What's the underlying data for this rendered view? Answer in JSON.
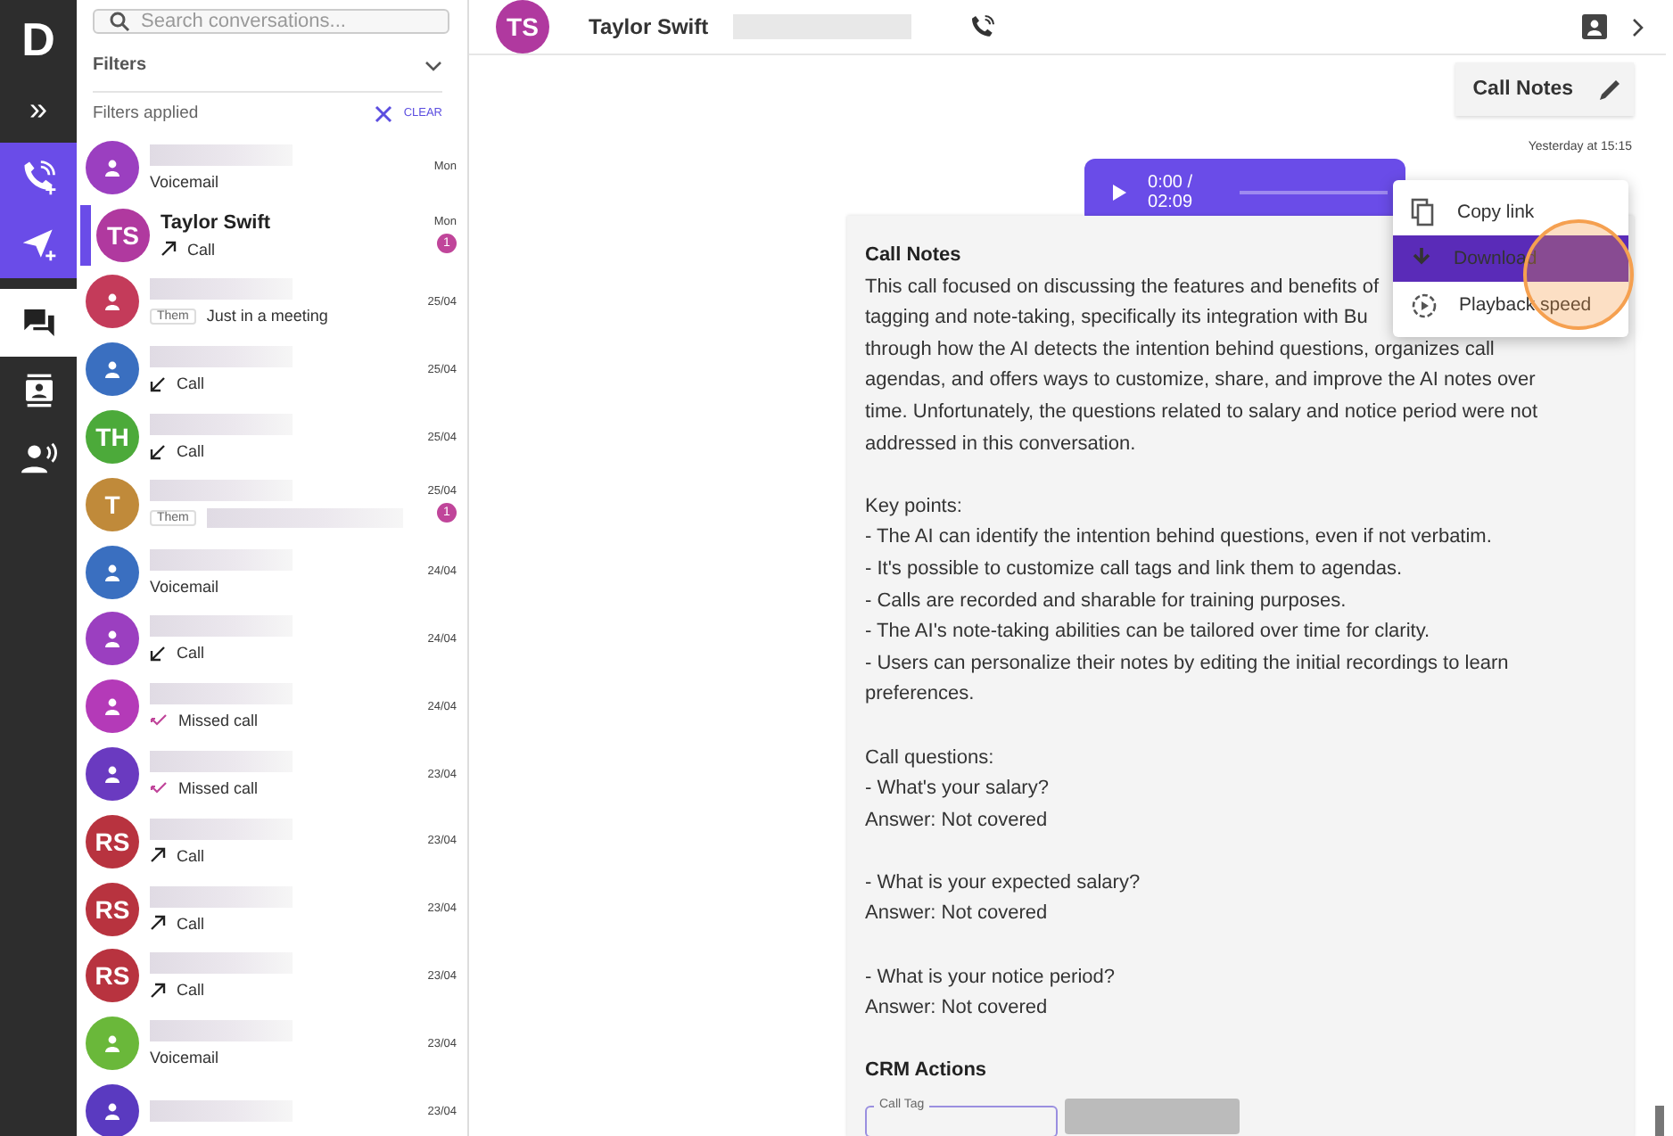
{
  "rail": {
    "logo": "D",
    "expand": "»",
    "items": [
      {
        "kind": "call",
        "accent": true,
        "selected": false
      },
      {
        "kind": "send",
        "accent": true,
        "selected": false
      },
      {
        "kind": "chat",
        "accent": false,
        "selected": true
      },
      {
        "kind": "contacts",
        "accent": false,
        "selected": false
      },
      {
        "kind": "voice",
        "accent": false,
        "selected": false
      }
    ]
  },
  "sidebar": {
    "search": {
      "placeholder": "Search conversations..."
    },
    "filters": {
      "label": "Filters",
      "expanded": false
    },
    "filters_applied": {
      "label": "Filters applied",
      "clear": "CLEAR"
    },
    "conversations": [
      {
        "avatar": {
          "kind": "person",
          "color": "#9b3fc0"
        },
        "date": "Mon",
        "preview": {
          "kind": "voicemail",
          "text": "Voicemail"
        },
        "selected": false
      },
      {
        "avatar": {
          "kind": "initials",
          "initials": "TS",
          "color": "#b0399f"
        },
        "name": "Taylor Swift",
        "date": "Mon",
        "badge": "1",
        "preview": {
          "kind": "outgoing",
          "text": "Call"
        },
        "selected": true
      },
      {
        "avatar": {
          "kind": "person",
          "color": "#c43b5a"
        },
        "date": "25/04",
        "preview": {
          "kind": "message",
          "tag": "Them",
          "text": "Just in a meeting"
        },
        "selected": false
      },
      {
        "avatar": {
          "kind": "person",
          "color": "#3a6fc0"
        },
        "date": "25/04",
        "preview": {
          "kind": "incoming",
          "text": "Call"
        },
        "selected": false
      },
      {
        "avatar": {
          "kind": "initials",
          "initials": "TH",
          "color": "#4caa3a"
        },
        "date": "25/04",
        "preview": {
          "kind": "incoming",
          "text": "Call"
        },
        "selected": false
      },
      {
        "avatar": {
          "kind": "initials",
          "initials": "T",
          "color": "#c08a3a"
        },
        "date": "25/04",
        "badge": "1",
        "preview": {
          "kind": "message",
          "tag": "Them"
        },
        "selected": false
      },
      {
        "avatar": {
          "kind": "person",
          "color": "#3a6fc0"
        },
        "date": "24/04",
        "preview": {
          "kind": "voicemail",
          "text": "Voicemail"
        },
        "selected": false
      },
      {
        "avatar": {
          "kind": "person",
          "color": "#9b3fc0"
        },
        "date": "24/04",
        "preview": {
          "kind": "incoming",
          "text": "Call"
        },
        "selected": false
      },
      {
        "avatar": {
          "kind": "person",
          "color": "#b43ab8"
        },
        "date": "24/04",
        "preview": {
          "kind": "missed",
          "text": "Missed call"
        },
        "selected": false
      },
      {
        "avatar": {
          "kind": "person",
          "color": "#6a3ac0"
        },
        "date": "23/04",
        "preview": {
          "kind": "missed",
          "text": "Missed call"
        },
        "selected": false
      },
      {
        "avatar": {
          "kind": "initials",
          "initials": "RS",
          "color": "#b8333f"
        },
        "date": "23/04",
        "preview": {
          "kind": "outgoing",
          "text": "Call"
        },
        "selected": false
      },
      {
        "avatar": {
          "kind": "initials",
          "initials": "RS",
          "color": "#b8333f"
        },
        "date": "23/04",
        "preview": {
          "kind": "outgoing",
          "text": "Call"
        },
        "selected": false
      },
      {
        "avatar": {
          "kind": "initials",
          "initials": "RS",
          "color": "#b8333f"
        },
        "date": "23/04",
        "preview": {
          "kind": "outgoing",
          "text": "Call"
        },
        "selected": false
      },
      {
        "avatar": {
          "kind": "person",
          "color": "#6ab83a"
        },
        "date": "23/04",
        "preview": {
          "kind": "voicemail",
          "text": "Voicemail"
        },
        "selected": false
      },
      {
        "avatar": {
          "kind": "person",
          "color": "#5a3ac0"
        },
        "date": "23/04",
        "selected": false
      }
    ]
  },
  "header": {
    "avatar": {
      "initials": "TS",
      "color": "#b0399f"
    },
    "name": "Taylor Swift"
  },
  "call_notes_button": "Call Notes",
  "message": {
    "time": "Yesterday at 15:15",
    "player": {
      "time": "0:00 / 02:09"
    },
    "menu": [
      {
        "kind": "copy",
        "label": "Copy link",
        "selected": false
      },
      {
        "kind": "download",
        "label": "Download",
        "selected": true
      },
      {
        "kind": "speed",
        "label": "Playback speed",
        "selected": false
      }
    ],
    "notes": [
      {
        "kind": "heading",
        "text": "Call Notes"
      },
      {
        "kind": "line",
        "text": "This call focused on discussing the features and benefits of"
      },
      {
        "kind": "line",
        "text": "tagging and note-taking, specifically its integration with Bu"
      },
      {
        "kind": "line",
        "text": "through how the AI detects the intention behind questions, organizes call"
      },
      {
        "kind": "line",
        "text": "agendas, and offers ways to customize, share, and improve the AI notes over"
      },
      {
        "kind": "line",
        "text": "time. Unfortunately, the questions related to salary and notice period were not"
      },
      {
        "kind": "line",
        "text": "addressed in this conversation."
      },
      {
        "kind": "gap"
      },
      {
        "kind": "line",
        "text": "Key points:"
      },
      {
        "kind": "line",
        "text": "- The AI can identify the intention behind questions, even if not verbatim."
      },
      {
        "kind": "line",
        "text": "- It's possible to customize call tags and link them to agendas."
      },
      {
        "kind": "line",
        "text": "- Calls are recorded and sharable for training purposes."
      },
      {
        "kind": "line",
        "text": "- The AI's note-taking abilities can be tailored over time for clarity."
      },
      {
        "kind": "line",
        "text": "- Users can personalize their notes by editing the initial recordings to learn"
      },
      {
        "kind": "line",
        "text": "preferences."
      },
      {
        "kind": "gap"
      },
      {
        "kind": "line",
        "text": "Call questions:"
      },
      {
        "kind": "line",
        "text": "- What's your salary?"
      },
      {
        "kind": "line",
        "text": "Answer: Not covered"
      },
      {
        "kind": "gap"
      },
      {
        "kind": "line",
        "text": "- What is your expected salary?"
      },
      {
        "kind": "line",
        "text": "Answer: Not covered"
      },
      {
        "kind": "gap"
      },
      {
        "kind": "line",
        "text": "- What is your notice period?"
      },
      {
        "kind": "line",
        "text": "Answer: Not covered"
      },
      {
        "kind": "gap"
      },
      {
        "kind": "heading",
        "text": "CRM Actions"
      }
    ],
    "crm_field": {
      "label": "Call Tag"
    }
  }
}
